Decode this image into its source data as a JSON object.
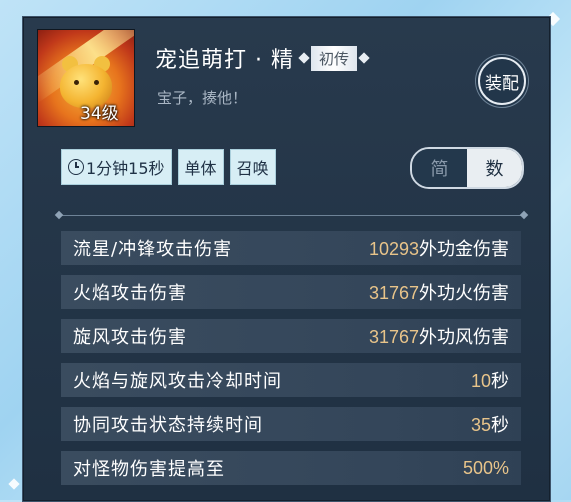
{
  "skill": {
    "name": "宠追萌打 · 精",
    "rank": "初传",
    "description": "宝子，揍他！",
    "level": "34级",
    "equip_label": "装配"
  },
  "tags": {
    "cooldown": "1分钟15秒",
    "target": "单体",
    "type": "召唤"
  },
  "toggle": {
    "simple": "简",
    "numeric": "数",
    "selected": "数"
  },
  "stats": [
    {
      "label": "流星/冲锋攻击伤害",
      "number": "10293",
      "unit": "外功金伤害"
    },
    {
      "label": "火焰攻击伤害",
      "number": "31767",
      "unit": "外功火伤害"
    },
    {
      "label": "旋风攻击伤害",
      "number": "31767",
      "unit": "外功风伤害"
    },
    {
      "label": "火焰与旋风攻击冷却时间",
      "number": "10",
      "unit": "秒"
    },
    {
      "label": "协同攻击状态持续时间",
      "number": "35",
      "unit": "秒"
    },
    {
      "label": "对怪物伤害提高至",
      "number": "500%",
      "unit": ""
    }
  ],
  "colors": {
    "panel_bg": "#283a4d",
    "value_gold": "#e8c48a",
    "tag_bg": "#d7eef5"
  }
}
